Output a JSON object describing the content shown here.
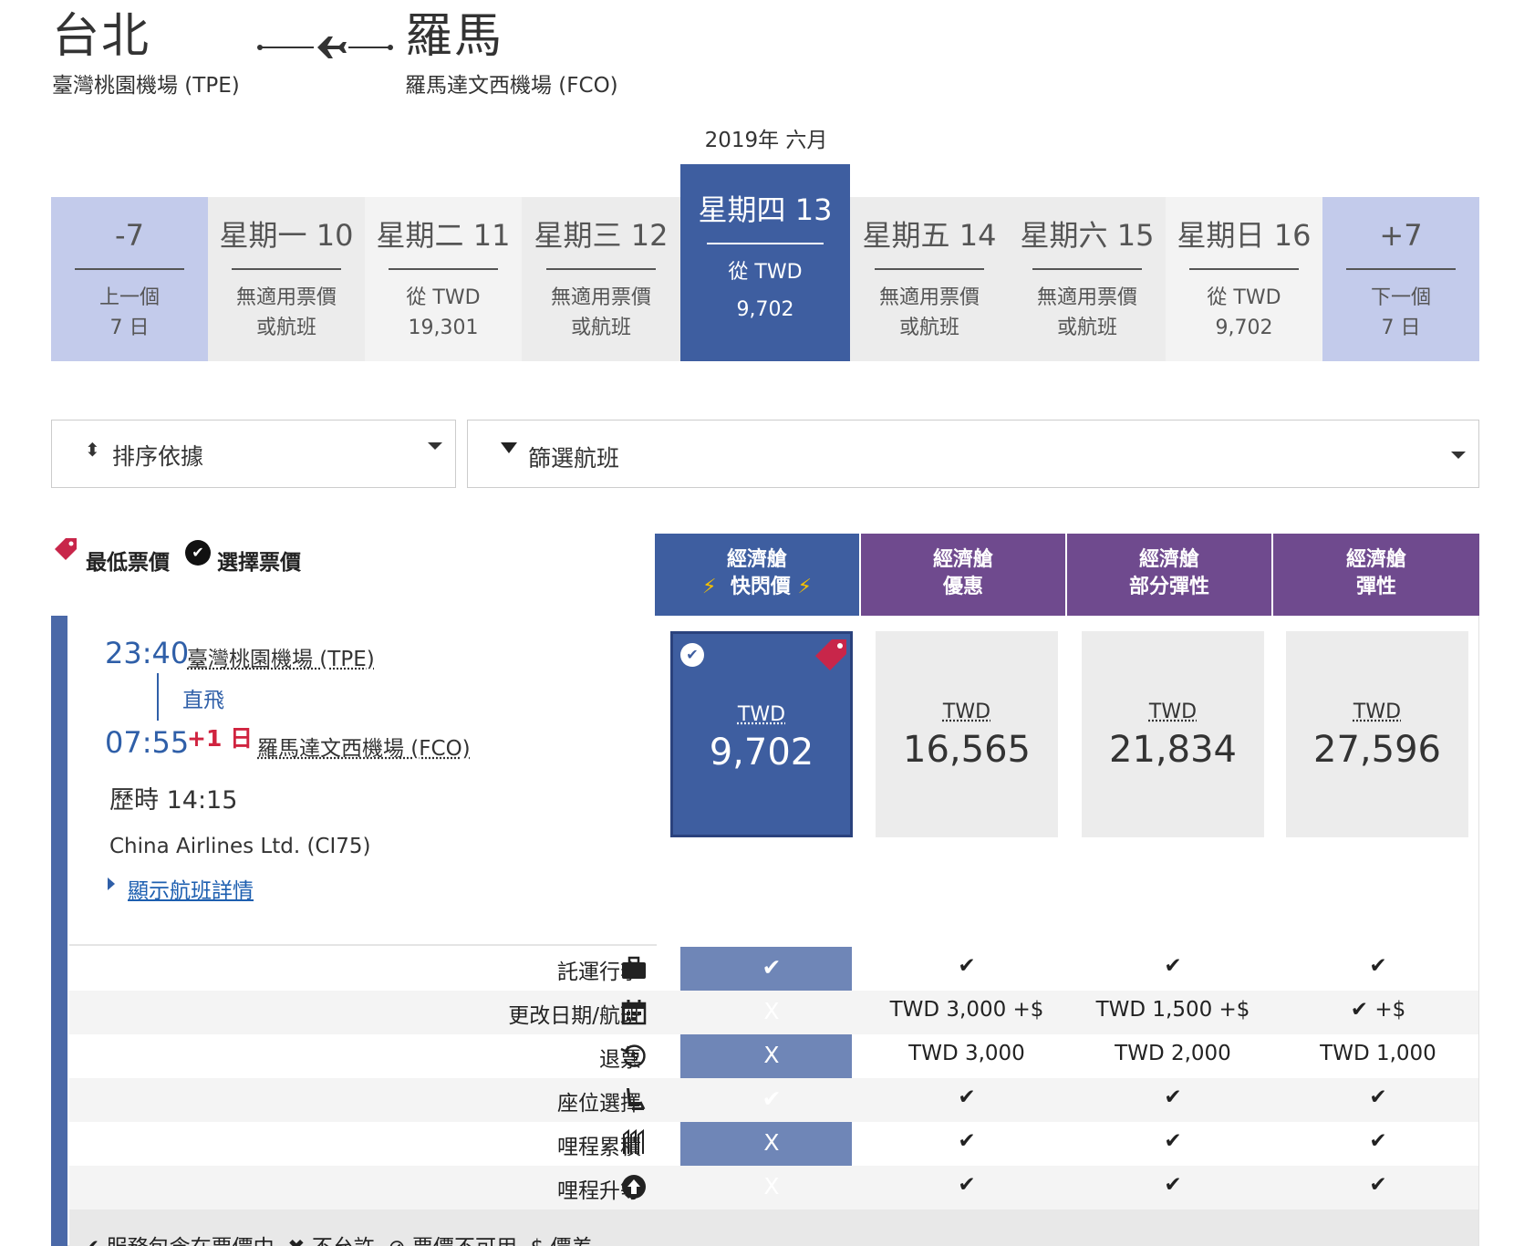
{
  "route": {
    "origin_city": "台北",
    "origin_airport": "臺灣桃園機場 (TPE)",
    "dest_city": "羅馬",
    "dest_airport": "羅馬達文西機場 (FCO)"
  },
  "calendar": {
    "month": "2019年 六月",
    "prev": {
      "top": "-7",
      "line1": "上一個",
      "line2": "7 日"
    },
    "next": {
      "top": "+7",
      "line1": "下一個",
      "line2": "7 日"
    },
    "days": [
      {
        "label": "星期一 10",
        "line1": "無適用票價",
        "line2": "或航班"
      },
      {
        "label": "星期二 11",
        "line1": "從 TWD",
        "line2": "19,301"
      },
      {
        "label": "星期三 12",
        "line1": "無適用票價",
        "line2": "或航班"
      },
      {
        "label": "星期四 13",
        "line1": "從 TWD",
        "line2": "9,702"
      },
      {
        "label": "星期五 14",
        "line1": "無適用票價",
        "line2": "或航班"
      },
      {
        "label": "星期六 15",
        "line1": "無適用票價",
        "line2": "或航班"
      },
      {
        "label": "星期日 16",
        "line1": "從 TWD",
        "line2": "9,702"
      }
    ]
  },
  "sort": {
    "label": "排序依據"
  },
  "filter": {
    "label": "篩選航班"
  },
  "legend": {
    "lowest": "最低票價",
    "selected": "選擇票價"
  },
  "cabins": [
    {
      "line1": "經濟艙",
      "line2": "快閃價",
      "color": "#3e5ea0"
    },
    {
      "line1": "經濟艙",
      "line2": "優惠",
      "color": "#6f4a8e"
    },
    {
      "line1": "經濟艙",
      "line2": "部分彈性",
      "color": "#6f4a8e"
    },
    {
      "line1": "經濟艙",
      "line2": "彈性",
      "color": "#6f4a8e"
    }
  ],
  "flight": {
    "dep_time": "23:40",
    "dep_airport": "臺灣桃園機場 (TPE)",
    "type": "直飛",
    "arr_time": "07:55",
    "arr_offset": "+1 日",
    "arr_airport": "羅馬達文西機場 (FCO)",
    "duration": "歷時 14:15",
    "carrier": "China Airlines Ltd. (CI75)",
    "details_link": "顯示航班詳情"
  },
  "prices": [
    {
      "currency": "TWD",
      "amount": "9,702"
    },
    {
      "currency": "TWD",
      "amount": "16,565"
    },
    {
      "currency": "TWD",
      "amount": "21,834"
    },
    {
      "currency": "TWD",
      "amount": "27,596"
    }
  ],
  "features": [
    {
      "label": "託運行李",
      "icon": "suitcase-icon",
      "values": [
        "✔",
        "✔",
        "✔",
        "✔"
      ]
    },
    {
      "label": "更改日期/航班",
      "icon": "calendar-icon",
      "values": [
        "X",
        "TWD 3,000 +$",
        "TWD 1,500 +$",
        "✔ +$"
      ]
    },
    {
      "label": "退票",
      "icon": "refund-icon",
      "values": [
        "X",
        "TWD 3,000",
        "TWD 2,000",
        "TWD 1,000"
      ]
    },
    {
      "label": "座位選擇",
      "icon": "seat-icon",
      "values": [
        "✔",
        "✔",
        "✔",
        "✔"
      ]
    },
    {
      "label": "哩程累積",
      "icon": "mileage-icon",
      "values": [
        "X",
        "✔",
        "✔",
        "✔"
      ]
    },
    {
      "label": "哩程升等",
      "icon": "upgrade-icon",
      "values": [
        "X",
        "✔",
        "✔",
        "✔"
      ]
    }
  ],
  "footer_legend": {
    "included": "服務包含在票價中",
    "not_allowed": "不允許",
    "unavailable": "票價不可用",
    "difference": "價差"
  }
}
